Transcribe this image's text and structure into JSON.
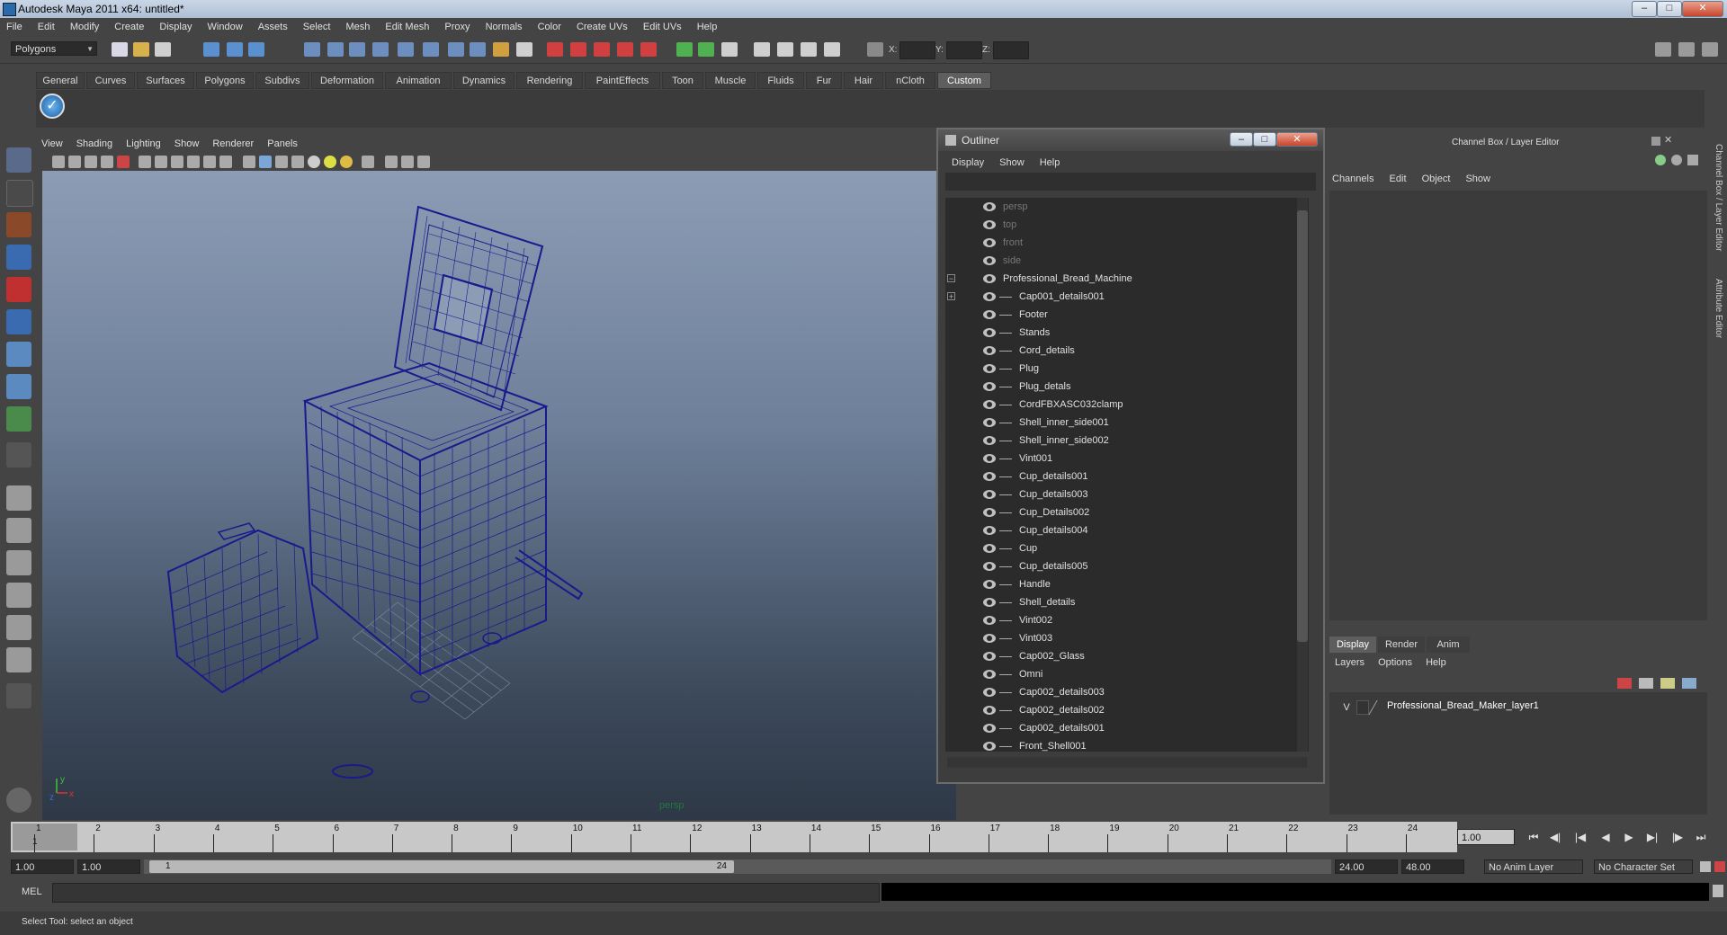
{
  "window": {
    "title": "Autodesk Maya 2011 x64: untitled*",
    "controls": [
      "minimize-icon",
      "maximize-icon",
      "close-icon"
    ]
  },
  "menubar": [
    "File",
    "Edit",
    "Modify",
    "Create",
    "Display",
    "Window",
    "Assets",
    "Select",
    "Mesh",
    "Edit Mesh",
    "Proxy",
    "Normals",
    "Color",
    "Create UVs",
    "Edit UVs",
    "Help"
  ],
  "statusline": {
    "menuset": "Polygons",
    "coord_labels": [
      "X:",
      "Y:",
      "Z:"
    ]
  },
  "shelf": {
    "tabs": [
      "General",
      "Curves",
      "Surfaces",
      "Polygons",
      "Subdivs",
      "Deformation",
      "Animation",
      "Dynamics",
      "Rendering",
      "PaintEffects",
      "Toon",
      "Muscle",
      "Fluids",
      "Fur",
      "Hair",
      "nCloth",
      "Custom"
    ],
    "active_tab": "Custom"
  },
  "viewport": {
    "menus": [
      "View",
      "Shading",
      "Lighting",
      "Show",
      "Renderer",
      "Panels"
    ],
    "camera_label": "persp",
    "axis": {
      "x": "x",
      "y": "y",
      "z": "z"
    },
    "wire_color": "#1a1a8c"
  },
  "outliner": {
    "title": "Outliner",
    "menus": [
      "Display",
      "Show",
      "Help"
    ],
    "cameras": [
      "persp",
      "top",
      "front",
      "side"
    ],
    "root": "Professional_Bread_Machine",
    "children": [
      "Cap001_details001",
      "Footer",
      "Stands",
      "Cord_details",
      "Plug",
      "Plug_detals",
      "CordFBXASC032clamp",
      "Shell_inner_side001",
      "Shell_inner_side002",
      "Vint001",
      "Cup_details001",
      "Cup_details003",
      "Cup_Details002",
      "Cup_details004",
      "Cup",
      "Cup_details005",
      "Handle",
      "Shell_details",
      "Vint002",
      "Vint003",
      "Cap002_Glass",
      "Omni",
      "Cap002_details003",
      "Cap002_details002",
      "Cap002_details001",
      "Front_Shell001"
    ]
  },
  "channelbox": {
    "title": "Channel Box / Layer Editor",
    "menus": [
      "Channels",
      "Edit",
      "Object",
      "Show"
    ],
    "layer_tabs": [
      "Display",
      "Render",
      "Anim"
    ],
    "active_layer_tab": "Display",
    "layer_menus": [
      "Layers",
      "Options",
      "Help"
    ],
    "layers": [
      {
        "visible": "V",
        "name": "Professional_Bread_Maker_layer1"
      }
    ],
    "side_tabs": [
      "Channel Box / Layer Editor",
      "Attribute Editor"
    ]
  },
  "timeline": {
    "ticks": [
      "1",
      "2",
      "3",
      "4",
      "5",
      "6",
      "7",
      "8",
      "9",
      "10",
      "11",
      "12",
      "13",
      "14",
      "15",
      "16",
      "17",
      "18",
      "19",
      "20",
      "21",
      "22",
      "23",
      "24"
    ],
    "current_frame": "1",
    "current_time_field": "1.00"
  },
  "range": {
    "start": "1.00",
    "playback_start": "1.00",
    "thumb_start": "1",
    "thumb_end": "24",
    "playback_end": "24.00",
    "end": "48.00",
    "anim_layer": "No Anim Layer",
    "character_set": "No Character Set"
  },
  "commandline": {
    "label": "MEL"
  },
  "helpline": "Select Tool: select an object"
}
